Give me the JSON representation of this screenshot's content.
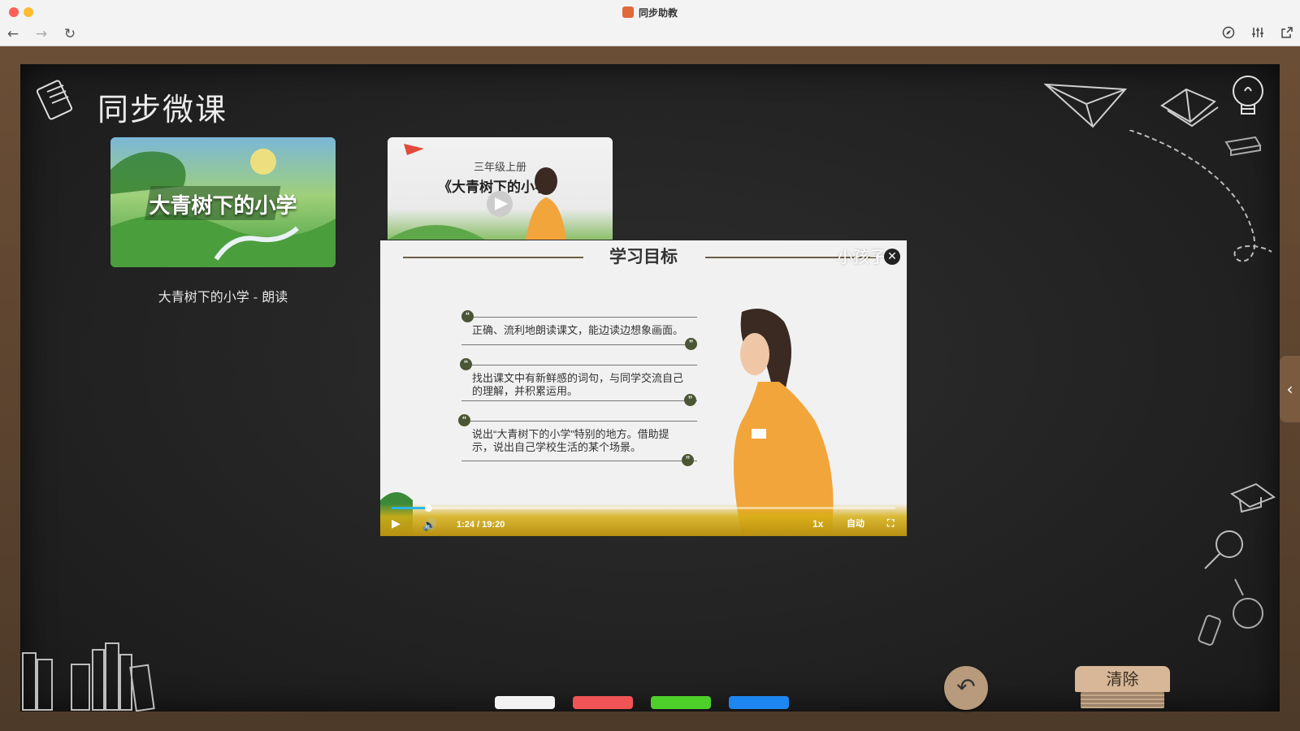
{
  "window": {
    "title": "同步助教"
  },
  "toolbar": {
    "back_icon": "back-arrow-icon",
    "forward_icon": "forward-arrow-icon",
    "reload_icon": "reload-icon",
    "compass_icon": "compass-icon",
    "settings_icon": "sliders-icon",
    "popout_icon": "popout-icon"
  },
  "page": {
    "title": "同步微课"
  },
  "cards": [
    {
      "thumb_text": "大青树下的小学",
      "caption": "大青树下的小学 - 朗读"
    },
    {
      "thumb_sub": "三年级上册",
      "thumb_title": "《大青树下的小学》"
    }
  ],
  "player": {
    "heading": "学习目标",
    "brand": "小孩子",
    "goals": [
      "正确、流利地朗读课文，能边读边想象画面。",
      "找出课文中有新鲜感的词句，与同学交流自己的理解，并积累运用。",
      "说出“大青树下的小学”特别的地方。借助提示，说出自己学校生活的某个场景。"
    ],
    "time": "1:24 / 19:20",
    "progress": 0.072,
    "speed": "1x",
    "quality": "自动"
  },
  "pens": [
    {
      "name": "white",
      "color": "#f2f2f2"
    },
    {
      "name": "red",
      "color": "#f05454"
    },
    {
      "name": "green",
      "color": "#4fcf2a"
    },
    {
      "name": "blue",
      "color": "#1e86f0"
    }
  ],
  "actions": {
    "clear_label": "清除"
  }
}
